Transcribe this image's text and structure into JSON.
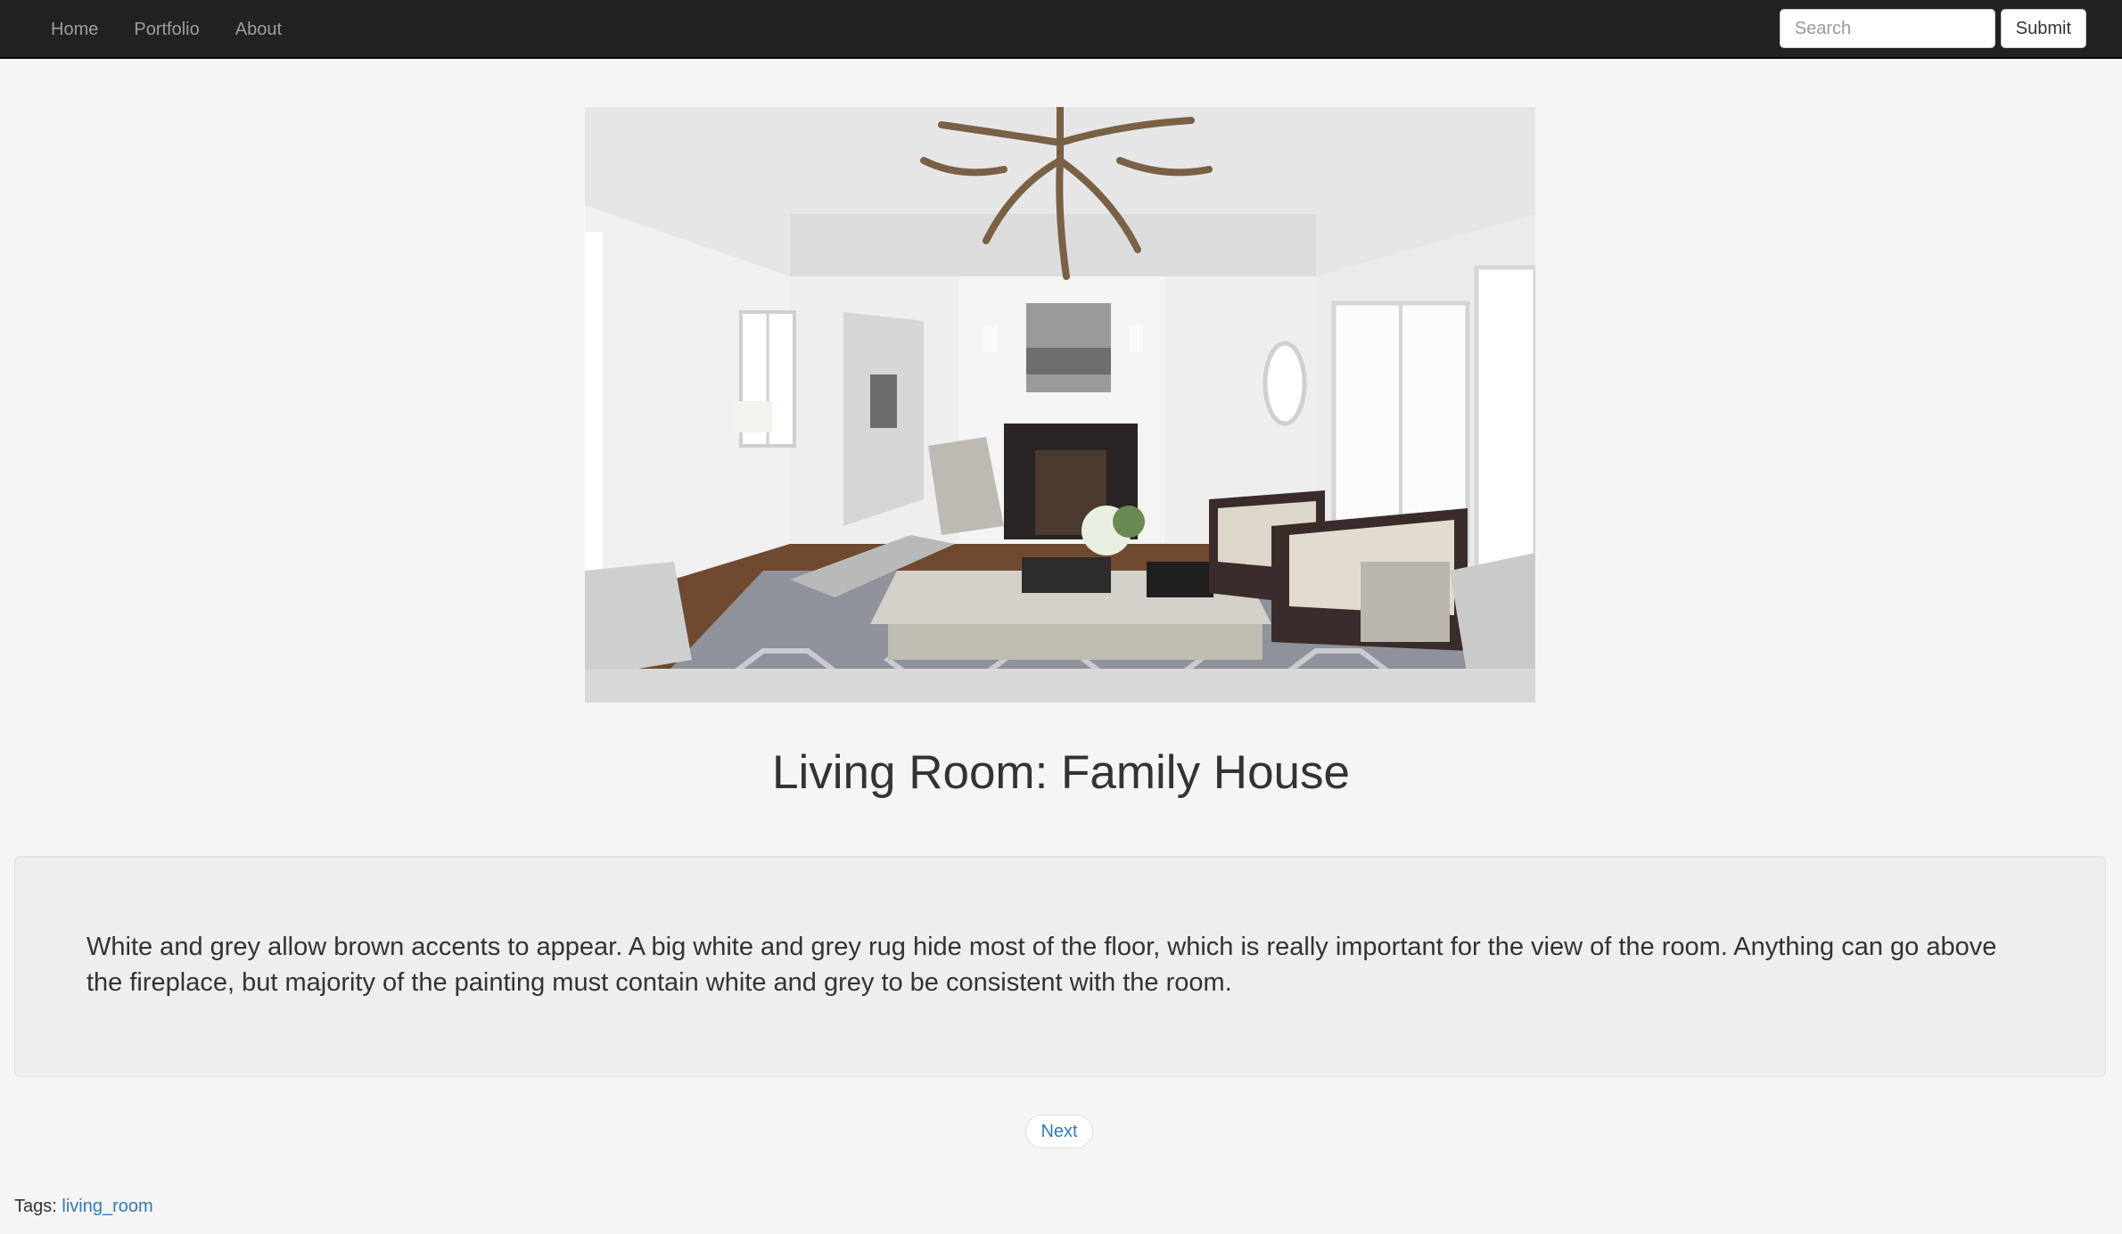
{
  "nav": {
    "links": [
      "Home",
      "Portfolio",
      "About"
    ],
    "search_placeholder": "Search",
    "submit_label": "Submit"
  },
  "article": {
    "image_description": "living-room-photo",
    "title": "Living Room: Family House",
    "description": "White and grey allow brown accents to appear. A big white and grey rug hide most of the floor, which is really important for the view of the room. Anything can go above the fireplace, but majority of the painting must contain white and grey to be consistent with the room."
  },
  "pager": {
    "next_label": "Next"
  },
  "tags": {
    "label": "Tags:",
    "items": [
      "living_room"
    ]
  },
  "colors": {
    "navbar": "#222222",
    "link": "#337ab7",
    "background": "#f5f5f5",
    "well": "#eeeeee"
  }
}
